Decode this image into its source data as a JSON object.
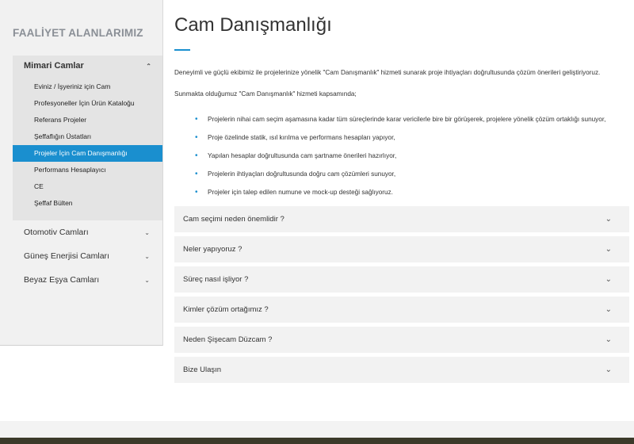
{
  "sidebar": {
    "title": "FAALİYET ALANLARIMIZ",
    "open_group": {
      "label": "Mimari Camlar",
      "chevron_icon": "chevron-up-icon",
      "items": [
        {
          "label": "Eviniz / İşyeriniz için Cam"
        },
        {
          "label": "Profesyoneller İçin Ürün Kataloğu"
        },
        {
          "label": "Referans Projeler"
        },
        {
          "label": "Şeffaflığın Üstatları"
        },
        {
          "label": "Projeler İçin Cam Danışmanlığı",
          "active": true
        },
        {
          "label": "Performans Hesaplayıcı"
        },
        {
          "label": "CE"
        },
        {
          "label": "Şeffaf Bülten"
        }
      ]
    },
    "categories": [
      {
        "label": "Otomotiv Camları",
        "chevron_icon": "chevron-down-icon"
      },
      {
        "label": "Güneş Enerjisi Camları",
        "chevron_icon": "chevron-down-icon"
      },
      {
        "label": "Beyaz Eşya Camları",
        "chevron_icon": "chevron-down-icon"
      }
    ]
  },
  "main": {
    "title": "Cam Danışmanlığı",
    "intro": "Deneyimli ve güçlü ekibimiz ile projelerinize yönelik \"Cam Danışmanlık\" hizmeti sunarak proje ihtiyaçları doğrultusunda çözüm önerileri geliştiriyoruz.",
    "scope": "Sunmakta olduğumuz \"Cam Danışmanlık\" hizmeti kapsamında;",
    "bullets": [
      "Projelerin nihai cam seçim aşamasına kadar tüm süreçlerinde karar vericilerle bire bir görüşerek, projelere yönelik çözüm ortaklığı sunuyor,",
      "Proje özelinde statik, ısıl kırılma ve performans hesapları yapıyor,",
      "Yapılan hesaplar doğrultusunda cam şartname önerileri hazırlıyor,",
      "Projelerin ihtiyaçları doğrultusunda doğru cam çözümleri sunuyor,",
      "Projeler için talep edilen numune ve mock-up desteği sağlıyoruz."
    ],
    "accordion": [
      "Cam seçimi neden önemlidir ?",
      "Neler yapıyoruz ?",
      "Süreç nasıl işliyor ?",
      "Kimler çözüm ortağımız ?",
      "Neden Şişecam Düzcam ?",
      "Bize Ulaşın"
    ],
    "accent_color": "#1a8fcf"
  }
}
